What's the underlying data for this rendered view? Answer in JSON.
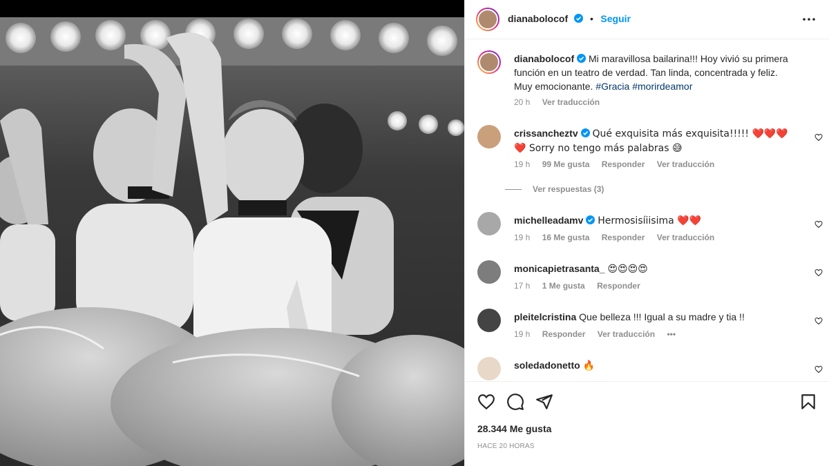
{
  "post": {
    "author": "dianabolocof",
    "follow_label": "Seguir",
    "follow_separator": "•",
    "more_icon": "more-horizontal-icon"
  },
  "caption": {
    "username": "dianabolocof",
    "text_1": "Mi maravillosa bailarina!!! Hoy vivió su primera función en un teatro de verdad. Tan linda, concentrada y feliz. Muy emocionante.",
    "hashtag_1": "#Gracia",
    "hashtag_2": "#morirdeamor",
    "time": "20 h",
    "translate": "Ver traducción"
  },
  "comments": [
    {
      "username": "crissancheztv",
      "verified": true,
      "text": "Qué exquisita más exquisita!!!!! ❤️❤️❤️❤️ Sorry no tengo más palabras 😅",
      "time": "19 h",
      "likes": "99 Me gusta",
      "reply": "Responder",
      "translate": "Ver traducción",
      "view_replies": "Ver respuestas (3)"
    },
    {
      "username": "michelleadamv",
      "verified": true,
      "text": "Hermosisíiisima ❤️❤️",
      "time": "19 h",
      "likes": "16 Me gusta",
      "reply": "Responder",
      "translate": "Ver traducción"
    },
    {
      "username": "monicapietrasanta_",
      "verified": false,
      "text": "😍😍😍😍",
      "time": "17 h",
      "likes": "1 Me gusta",
      "reply": "Responder"
    },
    {
      "username": "pleitelcristina",
      "verified": false,
      "text": "Que belleza !!! Igual a su madre y tia !!",
      "time": "19 h",
      "reply": "Responder",
      "translate": "Ver traducción",
      "more": "•••"
    },
    {
      "username": "soledadonetto",
      "verified": false,
      "text": "🔥"
    }
  ],
  "footer": {
    "likes": "28.344 Me gusta",
    "time_ago": "HACE 20 HORAS"
  },
  "colors": {
    "accent": "#0095f6",
    "hashtag": "#00376b",
    "heart": "#ed4956",
    "muted": "#8e8e8e"
  }
}
